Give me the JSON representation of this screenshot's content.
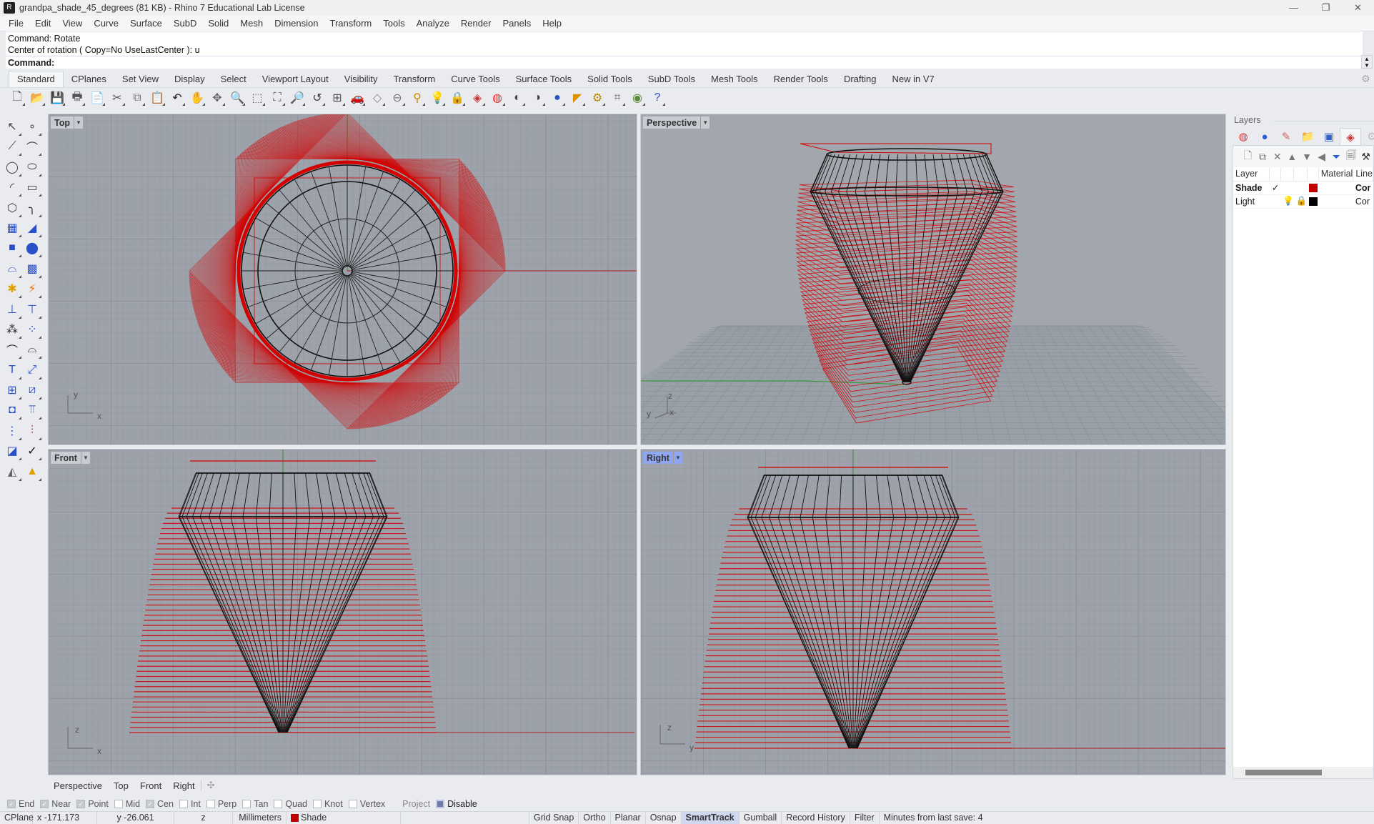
{
  "window": {
    "title": "grandpa_shade_45_degrees (81 KB) - Rhino 7 Educational Lab License",
    "controls": [
      "minimize",
      "restore",
      "close"
    ]
  },
  "menu": [
    "File",
    "Edit",
    "View",
    "Curve",
    "Surface",
    "SubD",
    "Solid",
    "Mesh",
    "Dimension",
    "Transform",
    "Tools",
    "Analyze",
    "Render",
    "Panels",
    "Help"
  ],
  "command": {
    "history": [
      "Command: Rotate",
      "Center of rotation ( Copy=No  UseLastCenter ): u"
    ],
    "prompt_label": "Command:",
    "value": ""
  },
  "toolbar_tabs": {
    "active": "Standard",
    "items": [
      "Standard",
      "CPlanes",
      "Set View",
      "Display",
      "Select",
      "Viewport Layout",
      "Visibility",
      "Transform",
      "Curve Tools",
      "Surface Tools",
      "Solid Tools",
      "SubD Tools",
      "Mesh Tools",
      "Render Tools",
      "Drafting",
      "New in V7"
    ]
  },
  "standard_icons": [
    {
      "name": "new-file-icon",
      "glyph": "🗋"
    },
    {
      "name": "open-file-icon",
      "glyph": "📂"
    },
    {
      "name": "save-icon",
      "glyph": "💾"
    },
    {
      "name": "print-icon",
      "glyph": "🖶"
    },
    {
      "name": "import-icon",
      "glyph": "📄"
    },
    {
      "name": "cut-icon",
      "glyph": "✂"
    },
    {
      "name": "copy-icon",
      "glyph": "⧉"
    },
    {
      "name": "paste-icon",
      "glyph": "📋"
    },
    {
      "name": "undo-icon",
      "glyph": "↶"
    },
    {
      "name": "pan-icon",
      "glyph": "✋"
    },
    {
      "name": "rotate-view-icon",
      "glyph": "✥"
    },
    {
      "name": "zoom-icon",
      "glyph": "🔍"
    },
    {
      "name": "zoom-window-icon",
      "glyph": "⬚"
    },
    {
      "name": "zoom-extents-icon",
      "glyph": "⛶"
    },
    {
      "name": "zoom-selected-icon",
      "glyph": "🔎"
    },
    {
      "name": "undo-view-icon",
      "glyph": "↺"
    },
    {
      "name": "four-view-icon",
      "glyph": "⊞"
    },
    {
      "name": "named-view-icon",
      "glyph": "🚗"
    },
    {
      "name": "cplane-icon",
      "glyph": "◇"
    },
    {
      "name": "distance-icon",
      "glyph": "⊖"
    },
    {
      "name": "object-properties-icon",
      "glyph": "⚲"
    },
    {
      "name": "light-bulb-icon",
      "glyph": "💡"
    },
    {
      "name": "lock-icon",
      "glyph": "🔒"
    },
    {
      "name": "layers-icon",
      "glyph": "◈"
    },
    {
      "name": "color-wheel-icon",
      "glyph": "◍"
    },
    {
      "name": "shaded-icon",
      "glyph": "◐"
    },
    {
      "name": "rendered-icon",
      "glyph": "◑"
    },
    {
      "name": "render-sphere-icon",
      "glyph": "●"
    },
    {
      "name": "gumball-icon",
      "glyph": "◤"
    },
    {
      "name": "options-gear-icon",
      "glyph": "⚙"
    },
    {
      "name": "grid-snap-icon",
      "glyph": "⌗"
    },
    {
      "name": "check-model-icon",
      "glyph": "◉"
    },
    {
      "name": "help-icon",
      "glyph": "?"
    }
  ],
  "left_tools": [
    {
      "name": "select-icon",
      "glyph": "↖"
    },
    {
      "name": "point-icon",
      "glyph": "∘"
    },
    {
      "name": "polyline-icon",
      "glyph": "⟋"
    },
    {
      "name": "curve-icon",
      "glyph": "⌒"
    },
    {
      "name": "circle-icon",
      "glyph": "◯"
    },
    {
      "name": "ellipse-icon",
      "glyph": "⬭"
    },
    {
      "name": "arc-icon",
      "glyph": "◜"
    },
    {
      "name": "rectangle-icon",
      "glyph": "▭"
    },
    {
      "name": "polygon-icon",
      "glyph": "⬡"
    },
    {
      "name": "fillet-curve-icon",
      "glyph": "╮"
    },
    {
      "name": "surface-icon",
      "glyph": "▦"
    },
    {
      "name": "loft-icon",
      "glyph": "◢"
    },
    {
      "name": "box-icon",
      "glyph": "■"
    },
    {
      "name": "boolean-union-icon",
      "glyph": "⬤"
    },
    {
      "name": "extrude-icon",
      "glyph": "⌓"
    },
    {
      "name": "mesh-icon",
      "glyph": "▩"
    },
    {
      "name": "explode-icon",
      "glyph": "✱"
    },
    {
      "name": "split-icon",
      "glyph": "⚡"
    },
    {
      "name": "trim-icon",
      "glyph": "⊥"
    },
    {
      "name": "join-icon",
      "glyph": "⊤"
    },
    {
      "name": "group-icon",
      "glyph": "⁂"
    },
    {
      "name": "points-on-icon",
      "glyph": "⁘"
    },
    {
      "name": "offset-icon",
      "glyph": "⌒"
    },
    {
      "name": "offset-curve-icon",
      "glyph": "⌓"
    },
    {
      "name": "text-icon",
      "glyph": "T"
    },
    {
      "name": "move-icon",
      "glyph": "⤢"
    },
    {
      "name": "array-icon",
      "glyph": "⊞"
    },
    {
      "name": "orient-icon",
      "glyph": "⧄"
    },
    {
      "name": "shell-icon",
      "glyph": "◘"
    },
    {
      "name": "project-icon",
      "glyph": "⫪"
    },
    {
      "name": "grid-array-icon",
      "glyph": "⋮"
    },
    {
      "name": "dimension-icon",
      "glyph": "⫶"
    },
    {
      "name": "analyze-icon",
      "glyph": "◪"
    },
    {
      "name": "check-icon",
      "glyph": "✓"
    },
    {
      "name": "render-mesh-icon",
      "glyph": "◭"
    },
    {
      "name": "light-icon",
      "glyph": "▲"
    }
  ],
  "viewports": {
    "top": {
      "label": "Top",
      "axes": [
        "x",
        "y"
      ]
    },
    "perspective": {
      "label": "Perspective",
      "axes": [
        "x",
        "y",
        "z"
      ]
    },
    "front": {
      "label": "Front",
      "axes": [
        "x",
        "z"
      ]
    },
    "right": {
      "label": "Right",
      "axes": [
        "y",
        "z"
      ],
      "active": true
    }
  },
  "viewport_tabs": {
    "items": [
      "Perspective",
      "Top",
      "Front",
      "Right"
    ],
    "active": "Right",
    "add_glyph": "✣"
  },
  "layers_panel": {
    "title": "Layers",
    "tab_icons": [
      "color-wheel-icon",
      "materials-icon",
      "display-mode-icon",
      "files-icon",
      "help-panel-icon",
      "layers-tab-icon",
      "settings-icon"
    ],
    "tools": [
      "new-layer-icon",
      "new-sublayer-icon",
      "delete-icon",
      "move-up-icon",
      "move-down-icon",
      "move-left-icon",
      "filter-icon",
      "copy-icon",
      "tools-icon"
    ],
    "columns": [
      "Layer",
      "",
      "",
      "",
      "",
      "Material",
      "Line"
    ],
    "rows": [
      {
        "name": "Shade",
        "current": true,
        "check": "✓",
        "visible": true,
        "locked": false,
        "color": "#c00000",
        "linetype": "Cor"
      },
      {
        "name": "Light",
        "current": false,
        "check": "",
        "visible": true,
        "locked": true,
        "color": "#000000",
        "linetype": "Cor"
      }
    ]
  },
  "osnaps": [
    {
      "label": "End",
      "checked": true
    },
    {
      "label": "Near",
      "checked": true
    },
    {
      "label": "Point",
      "checked": true
    },
    {
      "label": "Mid",
      "checked": false
    },
    {
      "label": "Cen",
      "checked": true
    },
    {
      "label": "Int",
      "checked": false
    },
    {
      "label": "Perp",
      "checked": false
    },
    {
      "label": "Tan",
      "checked": false
    },
    {
      "label": "Quad",
      "checked": false
    },
    {
      "label": "Knot",
      "checked": false
    },
    {
      "label": "Vertex",
      "checked": false
    },
    {
      "label": "Project",
      "checked": false
    },
    {
      "label": "Disable",
      "checked": true
    }
  ],
  "status": {
    "cplane": "CPlane",
    "x": "x -171.173",
    "y": "y -26.061",
    "z": "z",
    "units": "Millimeters",
    "layer": "Shade",
    "layer_color": "#c00000",
    "toggles": [
      {
        "label": "Grid Snap",
        "on": false
      },
      {
        "label": "Ortho",
        "on": false
      },
      {
        "label": "Planar",
        "on": false
      },
      {
        "label": "Osnap",
        "on": false
      },
      {
        "label": "SmartTrack",
        "on": true
      },
      {
        "label": "Gumball",
        "on": false
      },
      {
        "label": "Record History",
        "on": false
      },
      {
        "label": "Filter",
        "on": false
      }
    ],
    "save_info": "Minutes from last save: 4"
  },
  "colors": {
    "accent_active_viewport": "#8fa6f2",
    "curve_red": "#d40000",
    "viewport_bg": "#9ea3ab"
  }
}
